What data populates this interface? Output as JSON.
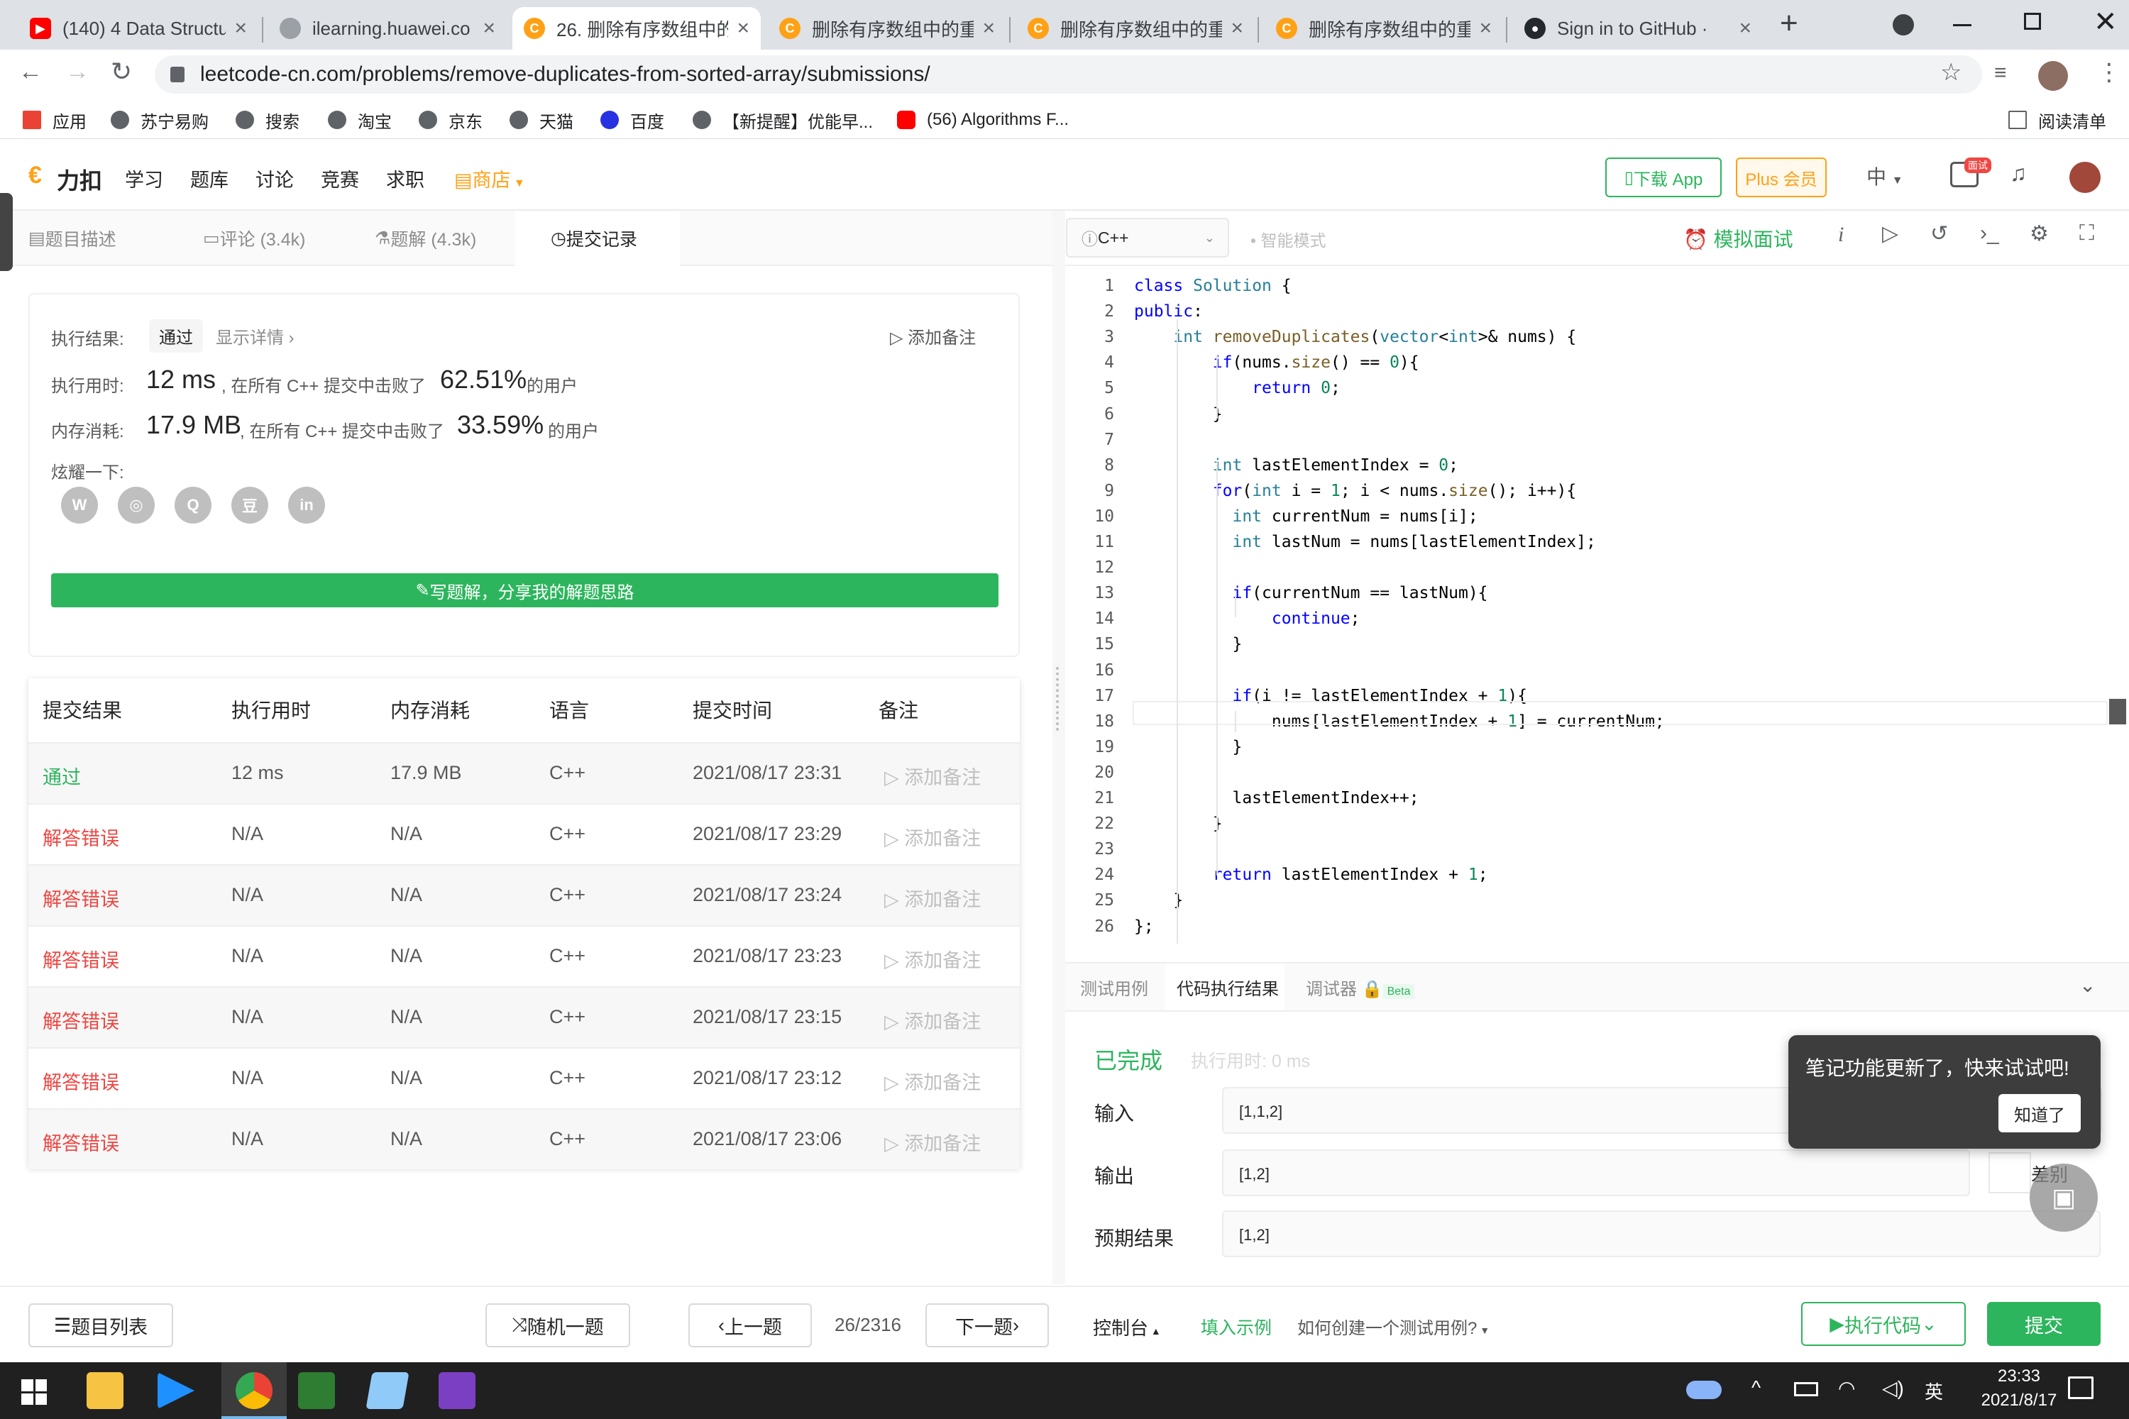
{
  "browser": {
    "tabs": [
      {
        "title": "(140) 4 Data Structu",
        "favicon": "youtube-icon"
      },
      {
        "title": "ilearning.huawei.co",
        "favicon": "globe-icon"
      },
      {
        "title": "26. 删除有序数组中的",
        "favicon": "leetcode-icon"
      },
      {
        "title": "删除有序数组中的重",
        "favicon": "leetcode-icon"
      },
      {
        "title": "删除有序数组中的重",
        "favicon": "leetcode-icon"
      },
      {
        "title": "删除有序数组中的重",
        "favicon": "leetcode-icon"
      },
      {
        "title": "Sign in to GitHub ·",
        "favicon": "github-icon"
      }
    ],
    "new_tab": "+",
    "url": "leetcode-cn.com/problems/remove-duplicates-from-sorted-array/submissions/",
    "bookmarks": [
      "应用",
      "苏宁易购",
      "搜索",
      "淘宝",
      "京东",
      "天猫",
      "百度",
      "【新提醒】优能早...",
      "(56) Algorithms F..."
    ],
    "reading_list": "阅读清单"
  },
  "header": {
    "logo": "力扣",
    "nav": [
      "学习",
      "题库",
      "讨论",
      "竞赛",
      "求职"
    ],
    "shop": "商店",
    "download_app": "下载 App",
    "plus": "Plus 会员",
    "lang": "中",
    "badge": "面试"
  },
  "left_tabs": [
    "题目描述",
    "评论 (3.4k)",
    "题解 (4.3k)",
    "提交记录"
  ],
  "result": {
    "status_label": "执行结果:",
    "status": "通过",
    "details": "显示详情",
    "add_note": "添加备注",
    "runtime_label": "执行用时:",
    "runtime": "12 ms",
    "runtime_text": ", 在所有 C++ 提交中击败了",
    "runtime_pct": "62.51%",
    "users": "的用户",
    "memory_label": "内存消耗:",
    "memory": "17.9 MB",
    "memory_text": ", 在所有 C++ 提交中击败了",
    "memory_pct": "33.59%",
    "share_label": "炫耀一下:",
    "write_solution": "写题解，分享我的解题思路"
  },
  "table": {
    "headers": [
      "提交结果",
      "执行用时",
      "内存消耗",
      "语言",
      "提交时间",
      "备注"
    ],
    "rows": [
      {
        "result": "通过",
        "time": "12 ms",
        "mem": "17.9 MB",
        "lang": "C++",
        "date": "2021/08/17 23:31",
        "note": "添加备注"
      },
      {
        "result": "解答错误",
        "time": "N/A",
        "mem": "N/A",
        "lang": "C++",
        "date": "2021/08/17 23:29",
        "note": "添加备注"
      },
      {
        "result": "解答错误",
        "time": "N/A",
        "mem": "N/A",
        "lang": "C++",
        "date": "2021/08/17 23:24",
        "note": "添加备注"
      },
      {
        "result": "解答错误",
        "time": "N/A",
        "mem": "N/A",
        "lang": "C++",
        "date": "2021/08/17 23:23",
        "note": "添加备注"
      },
      {
        "result": "解答错误",
        "time": "N/A",
        "mem": "N/A",
        "lang": "C++",
        "date": "2021/08/17 23:15",
        "note": "添加备注"
      },
      {
        "result": "解答错误",
        "time": "N/A",
        "mem": "N/A",
        "lang": "C++",
        "date": "2021/08/17 23:12",
        "note": "添加备注"
      },
      {
        "result": "解答错误",
        "time": "N/A",
        "mem": "N/A",
        "lang": "C++",
        "date": "2021/08/17 23:06",
        "note": "添加备注"
      }
    ]
  },
  "editor": {
    "language": "C++",
    "smart_mode": "智能模式",
    "mock_interview": "模拟面试",
    "code": [
      "class Solution {",
      "public:",
      "    int removeDuplicates(vector<int>& nums) {",
      "        if(nums.size() == 0){",
      "            return 0;",
      "        }",
      "",
      "        int lastElementIndex = 0;",
      "        for(int i = 1; i < nums.size(); i++){",
      "          int currentNum = nums[i];",
      "          int lastNum = nums[lastElementIndex];",
      "",
      "          if(currentNum == lastNum){",
      "              continue;",
      "          }",
      "",
      "          if(i != lastElementIndex + 1){",
      "              nums[lastElementIndex + 1] = currentNum;",
      "          }",
      "",
      "          lastElementIndex++;",
      "        }",
      "",
      "        return lastElementIndex + 1;",
      "    }",
      "};"
    ]
  },
  "bottom_panel": {
    "tabs": [
      "测试用例",
      "代码执行结果",
      "调试器"
    ],
    "beta": "Beta",
    "status": "已完成",
    "exec_time": "执行用时: 0 ms",
    "input_label": "输入",
    "input": "[1,1,2]",
    "output_label": "输出",
    "output": "[1,2]",
    "expected_label": "预期结果",
    "expected": "[1,2]",
    "diff": "差别"
  },
  "toast": {
    "text": "笔记功能更新了，快来试试吧!",
    "button": "知道了"
  },
  "footer": {
    "problem_list": "题目列表",
    "random": "随机一题",
    "prev": "上一题",
    "page": "26/2316",
    "next": "下一题",
    "console": "控制台",
    "fill_example": "填入示例",
    "how_to": "如何创建一个测试用例?",
    "run": "执行代码",
    "submit": "提交"
  },
  "taskbar": {
    "ime": "英",
    "time": "23:33",
    "date": "2021/8/17"
  },
  "colors": {
    "accent_green": "#2db55d",
    "error_red": "#ef4743",
    "shop_orange": "#ffa116"
  }
}
